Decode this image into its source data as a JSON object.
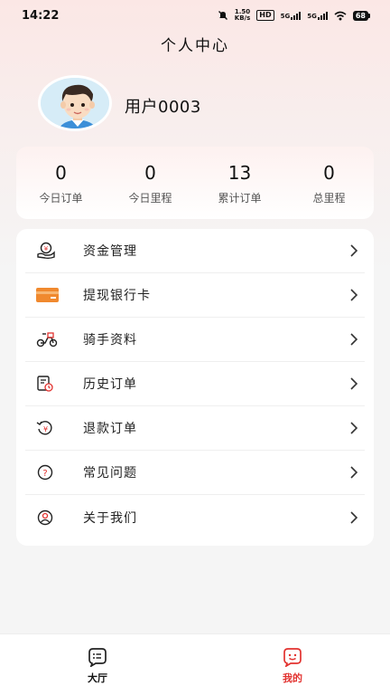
{
  "status_bar": {
    "time": "14:22",
    "net_speed_value": "1.50",
    "net_speed_unit": "KB/s",
    "hd_tag": "HD",
    "sim1": "5G",
    "sim2": "5G",
    "battery": "68"
  },
  "header": {
    "title": "个人中心"
  },
  "profile": {
    "username": "用户0003"
  },
  "stats": [
    {
      "value": "0",
      "label": "今日订单"
    },
    {
      "value": "0",
      "label": "今日里程"
    },
    {
      "value": "13",
      "label": "累计订单"
    },
    {
      "value": "0",
      "label": "总里程"
    }
  ],
  "menu": [
    {
      "label": "资金管理",
      "icon": "wallet-hand-icon"
    },
    {
      "label": "提现银行卡",
      "icon": "bank-card-icon"
    },
    {
      "label": "骑手资料",
      "icon": "scooter-icon"
    },
    {
      "label": "历史订单",
      "icon": "order-history-icon"
    },
    {
      "label": "退款订单",
      "icon": "refund-icon"
    },
    {
      "label": "常见问题",
      "icon": "question-icon"
    },
    {
      "label": "关于我们",
      "icon": "about-user-icon"
    }
  ],
  "tabbar": [
    {
      "label": "大厅",
      "icon": "lobby-icon",
      "active": false
    },
    {
      "label": "我的",
      "icon": "mine-icon",
      "active": true
    }
  ],
  "colors": {
    "accent": "#e2322f",
    "card_orange": "#f0892e",
    "text_dark": "#111111",
    "text_gray": "#555555"
  }
}
